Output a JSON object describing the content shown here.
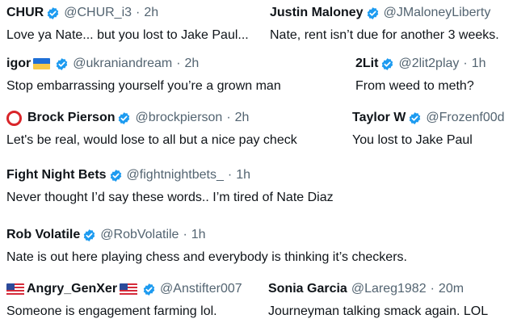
{
  "tweets": [
    {
      "name": "CHUR",
      "handle": "@CHUR_i3",
      "time": "2h",
      "text": "Love ya Nate... but you lost to Jake Paul..."
    },
    {
      "name": "Justin Maloney",
      "handle": "@JMaloneyLiberty",
      "time": "",
      "text": "Nate, rent isn’t due for another 3 weeks."
    },
    {
      "name": "igor",
      "handle": "@ukraniandream",
      "time": "2h",
      "text": "Stop embarrassing yourself you’re a grown man"
    },
    {
      "name": "2Lit",
      "handle": "@2lit2play",
      "time": "1h",
      "text": "From weed to meth?"
    },
    {
      "name": "Brock Pierson",
      "handle": "@brockpierson",
      "time": "2h",
      "text": "Let's be real, would lose to all but a nice pay check"
    },
    {
      "name": "Taylor W",
      "handle": "@Frozenf00d",
      "time": "",
      "text": "You lost to Jake Paul"
    },
    {
      "name": "Fight Night Bets",
      "handle": "@fightnightbets_",
      "time": "1h",
      "text": "Never thought I’d say these words.. I’m tired of Nate Diaz"
    },
    {
      "name": "Rob Volatile",
      "handle": "@RobVolatile",
      "time": "1h",
      "text": "Nate is out here playing chess and everybody is thinking it’s checkers."
    },
    {
      "name": "Angry_GenXer",
      "handle": "@Anstifter007",
      "time": "",
      "text": "Someone is engagement farming lol."
    },
    {
      "name": "Sonia Garcia",
      "handle": "@Lareg1982",
      "time": "20m",
      "text": "Journeyman talking smack again.  LOL"
    }
  ],
  "separator": "·",
  "colors": {
    "verified": "#1d9bf0",
    "meta": "#536471",
    "text": "#0f1419"
  }
}
